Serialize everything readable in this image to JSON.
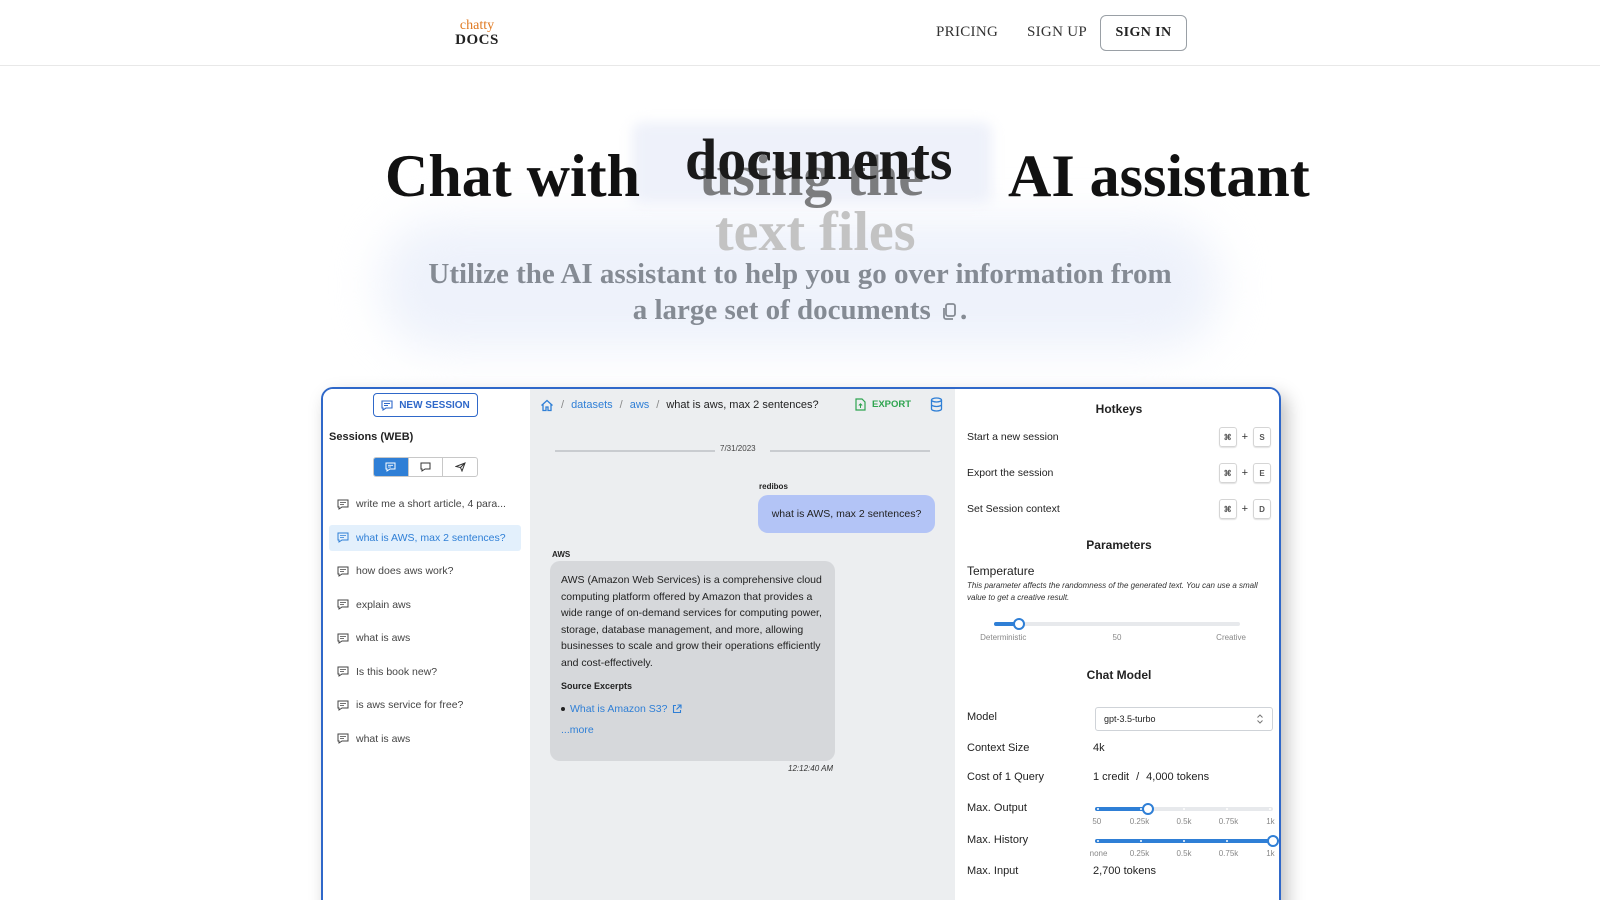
{
  "nav": {
    "logo_top": "chatty",
    "logo_bottom": "DOCS",
    "pricing": "PRICING",
    "sign_up": "SIGN UP",
    "sign_in": "SIGN IN"
  },
  "hero": {
    "headline_start": "Chat with",
    "rotating_current": "documents",
    "rotating_faded": "using the",
    "rotating_next": "text files",
    "headline_end": "AI assistant",
    "subtitle_line1": "Utilize the AI assistant to help you go over information from",
    "subtitle_line2": "a large set of documents",
    "subtitle_end": "."
  },
  "app": {
    "sidebar": {
      "new_session": "NEW SESSION",
      "sessions_title": "Sessions (WEB)",
      "active_index": 1,
      "sessions": [
        "write me a short article, 4 para...",
        "what is AWS, max 2 sentences?",
        "how does aws work?",
        "explain aws",
        "what is aws",
        "Is this book new?",
        "is aws service for free?",
        "what is aws"
      ]
    },
    "chat": {
      "breadcrumb": [
        "datasets",
        "aws",
        "what is aws, max 2 sentences?"
      ],
      "export": "EXPORT",
      "date": "7/31/2023",
      "user_name": "redibos",
      "user_message": "what is AWS, max 2 sentences?",
      "ai_name": "AWS",
      "ai_message": "AWS (Amazon Web Services) is a comprehensive cloud computing platform offered by Amazon that provides a wide range of on-demand services for computing power, storage, database management, and more, allowing businesses to scale and grow their operations efficiently and cost-effectively.",
      "source_title": "Source Excerpts",
      "source_link": "What is Amazon S3?",
      "more": "...more",
      "time": "12:12:40 AM"
    },
    "settings": {
      "hotkeys_title": "Hotkeys",
      "hotkeys": [
        {
          "label": "Start a new session",
          "mod": "⌘",
          "plus": "+",
          "key": "S"
        },
        {
          "label": "Export the session",
          "mod": "⌘",
          "plus": "+",
          "key": "E"
        },
        {
          "label": "Set Session context",
          "mod": "⌘",
          "plus": "+",
          "key": "D"
        }
      ],
      "parameters_title": "Parameters",
      "temperature_label": "Temperature",
      "temperature_desc": "This parameter affects the randomness of the generated text. You can use a small value to get a creative result.",
      "temperature_value": 0.1,
      "temperature_ticks": [
        "Deterministic",
        "50",
        "Creative"
      ],
      "chat_model_title": "Chat Model",
      "model_label": "Model",
      "model_value": "gpt-3.5-turbo",
      "context_size_label": "Context Size",
      "context_size_value": "4k",
      "cost_label": "Cost of 1 Query",
      "cost_credit": "1 credit",
      "cost_sep": "/",
      "cost_tokens": "4,000 tokens",
      "max_output_label": "Max. Output",
      "max_output_value": 0.3,
      "max_output_ticks": [
        "50",
        "0.25k",
        "0.5k",
        "0.75k",
        "1k"
      ],
      "max_history_label": "Max. History",
      "max_history_value": 1.0,
      "max_history_ticks": [
        "none",
        "0.25k",
        "0.5k",
        "0.75k",
        "1k"
      ],
      "max_input_label": "Max. Input",
      "max_input_value": "2,700 tokens"
    }
  },
  "colors": {
    "accent": "#2f7fd6",
    "frame": "#2f68c9",
    "logo_orange": "#e07a22",
    "export_green": "#2ea44f",
    "user_bubble": "#b3c4f6"
  }
}
